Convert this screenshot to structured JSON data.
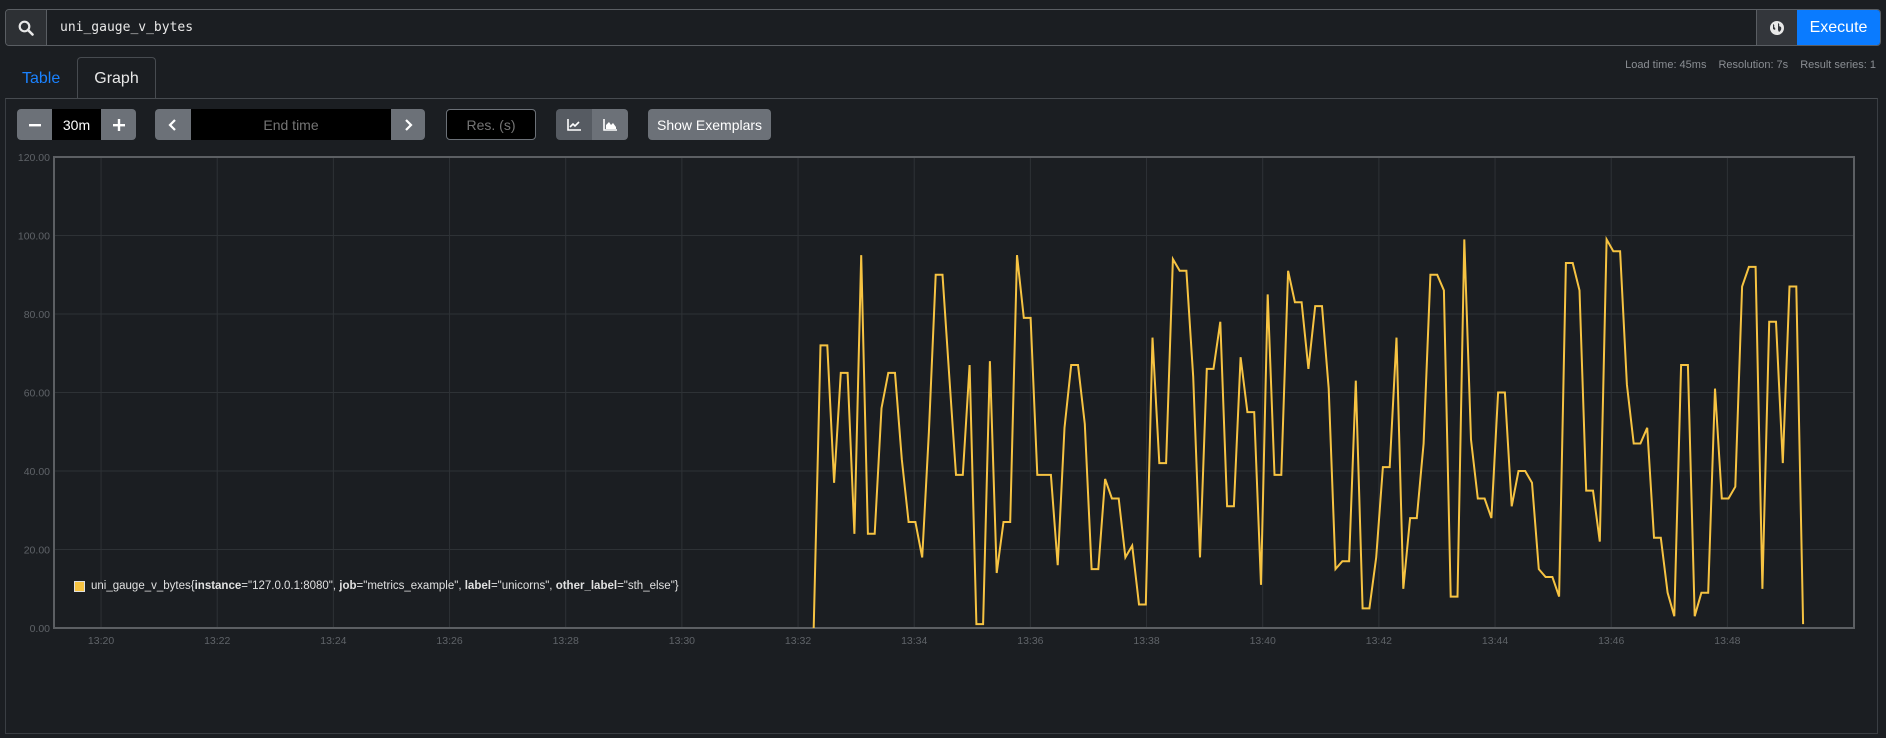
{
  "query": {
    "value": "uni_gauge_v_bytes",
    "execute_label": "Execute",
    "search_icon": "search-icon",
    "globe_icon": "globe-icon"
  },
  "stats": {
    "load_time": "Load time: 45ms",
    "resolution": "Resolution: 7s",
    "result_series": "Result series: 1"
  },
  "tabs": [
    {
      "label": "Table",
      "active": false
    },
    {
      "label": "Graph",
      "active": true
    }
  ],
  "controls": {
    "range_value": "30m",
    "end_time_placeholder": "End time",
    "res_placeholder": "Res. (s)",
    "show_exemplars_label": "Show Exemplars",
    "decrease_icon": "minus-icon",
    "increase_icon": "plus-icon",
    "prev_icon": "chevron-left-icon",
    "next_icon": "chevron-right-icon",
    "unstacked_icon": "line-chart-icon",
    "stacked_icon": "area-chart-icon"
  },
  "legend": {
    "metric": "uni_gauge_v_bytes",
    "labels": [
      {
        "key": "instance",
        "value": "\"127.0.0.1:8080\""
      },
      {
        "key": "job",
        "value": "\"metrics_example\""
      },
      {
        "key": "label",
        "value": "\"unicorns\""
      },
      {
        "key": "other_label",
        "value": "\"sth_else\""
      }
    ],
    "color": "#f6c342"
  },
  "chart_data": {
    "type": "line",
    "title": "",
    "xlabel": "",
    "ylabel": "",
    "x_unit": "minutes since 13:20",
    "xlim": [
      -0.81,
      30.18
    ],
    "ylim": [
      0,
      120
    ],
    "yticks": [
      "0.00",
      "20.00",
      "40.00",
      "60.00",
      "80.00",
      "100.00",
      "120.00"
    ],
    "xticks": [
      "13:20",
      "13:22",
      "13:24",
      "13:26",
      "13:28",
      "13:30",
      "13:32",
      "13:34",
      "13:36",
      "13:38",
      "13:40",
      "13:42",
      "13:44",
      "13:46",
      "13:48"
    ],
    "grid": true,
    "legend_position": "bottom-left",
    "series": [
      {
        "name": "uni_gauge_v_bytes{instance=\"127.0.0.1:8080\", job=\"metrics_example\", label=\"unicorns\", other_label=\"sth_else\"}",
        "color": "#f6c342",
        "start_minute": 12.27,
        "step_seconds": 7,
        "values": [
          0,
          72,
          72,
          37,
          65,
          65,
          24,
          95,
          24,
          24,
          56,
          65,
          65,
          43,
          27,
          27,
          18,
          50,
          90,
          90,
          64,
          39,
          39,
          67,
          1,
          1,
          68,
          14,
          27,
          27,
          95,
          79,
          79,
          39,
          39,
          39,
          16,
          51,
          67,
          67,
          52,
          15,
          15,
          38,
          33,
          33,
          18,
          21,
          6,
          6,
          74,
          42,
          42,
          94,
          91,
          91,
          64,
          18,
          66,
          66,
          78,
          31,
          31,
          69,
          55,
          55,
          11,
          85,
          39,
          39,
          91,
          83,
          83,
          66,
          82,
          82,
          61,
          15,
          17,
          17,
          63,
          5,
          5,
          18,
          41,
          41,
          74,
          10,
          28,
          28,
          47,
          90,
          90,
          86,
          8,
          8,
          99,
          48,
          33,
          33,
          28,
          60,
          60,
          31,
          40,
          40,
          37,
          15,
          13,
          13,
          8,
          93,
          93,
          86,
          35,
          35,
          22,
          99,
          96,
          96,
          62,
          47,
          47,
          51,
          23,
          23,
          9,
          3,
          67,
          67,
          3,
          9,
          9,
          61,
          33,
          33,
          36,
          87,
          92,
          92,
          10,
          78,
          78,
          42,
          87,
          87,
          1
        ]
      }
    ]
  }
}
